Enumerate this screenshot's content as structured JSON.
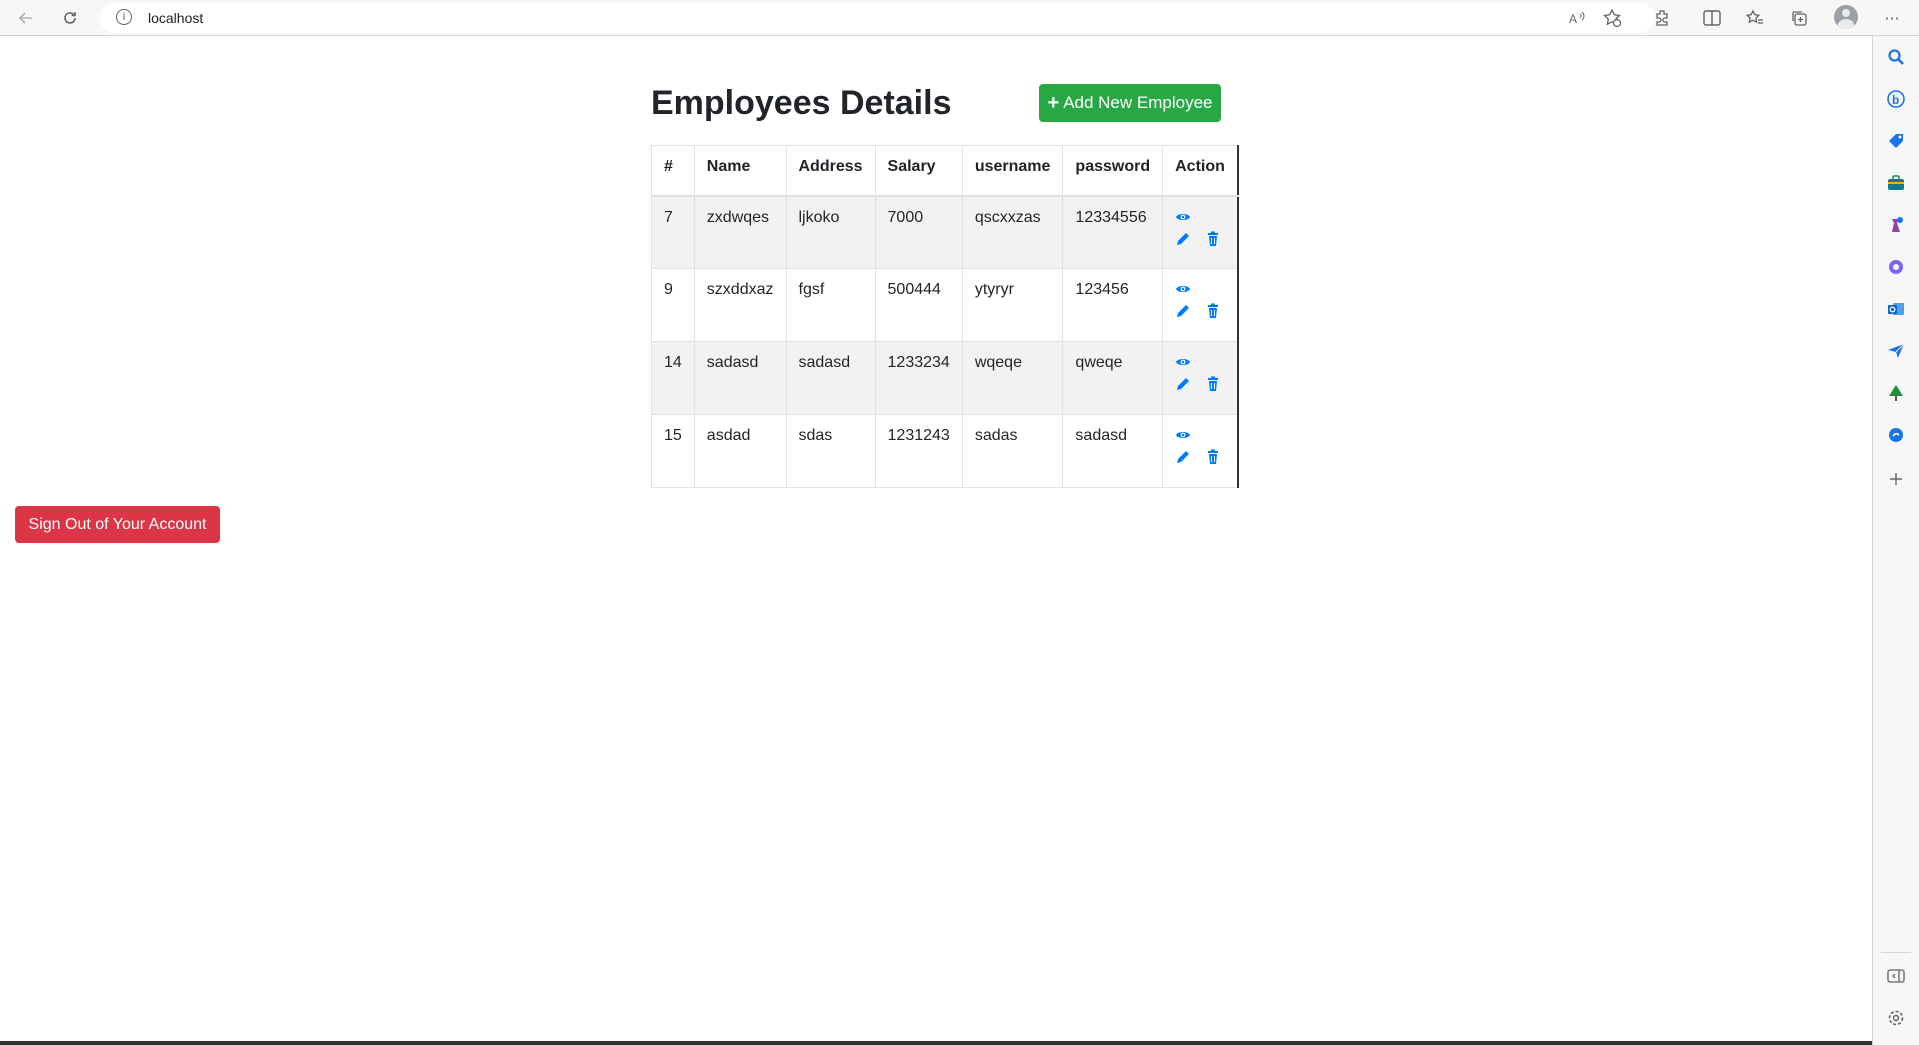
{
  "browser": {
    "url": "localhost",
    "more_label": "···"
  },
  "page": {
    "title": "Employees Details",
    "add_button_label": "Add New Employee",
    "signout_label": "Sign Out of Your Account"
  },
  "table": {
    "headers": [
      "#",
      "Name",
      "Address",
      "Salary",
      "username",
      "password",
      "Action"
    ],
    "rows": [
      {
        "id": "7",
        "name": "zxdwqes",
        "address": "ljkoko",
        "salary": "7000",
        "username": "qscxxzas",
        "password": "12334556"
      },
      {
        "id": "9",
        "name": "szxddxaz",
        "address": "fgsf",
        "salary": "500444",
        "username": "ytyryr",
        "password": "123456"
      },
      {
        "id": "14",
        "name": "sadasd",
        "address": "sadasd",
        "salary": "1233234",
        "username": "wqeqe",
        "password": "qweqe"
      },
      {
        "id": "15",
        "name": "asdad",
        "address": "sdas",
        "salary": "1231243",
        "username": "sadas",
        "password": "sadasd"
      }
    ]
  },
  "colors": {
    "success": "#28a745",
    "danger": "#dc3545",
    "primary": "#007bff"
  },
  "icons": [
    "back-icon",
    "reload-icon",
    "info-icon",
    "read-aloud-icon",
    "favorite-add-icon",
    "extensions-icon",
    "split-screen-icon",
    "favorites-icon",
    "collections-icon",
    "profile-icon",
    "more-icon",
    "view-icon",
    "edit-icon",
    "delete-icon"
  ]
}
